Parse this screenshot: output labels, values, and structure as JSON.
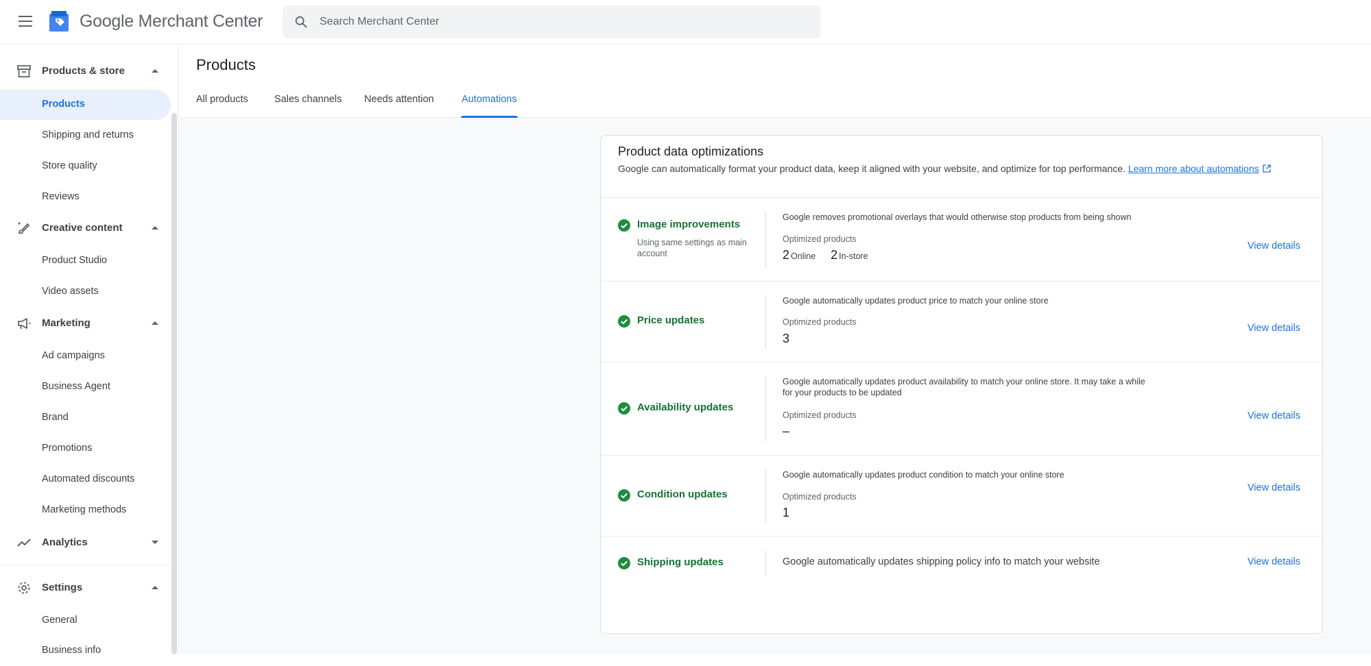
{
  "app": {
    "brand": "Google Merchant Center",
    "search_placeholder": "Search Merchant Center"
  },
  "sidebar": {
    "sections": [
      {
        "label": "Products & store",
        "icon": "store-icon",
        "expanded": true,
        "items": [
          {
            "label": "Products",
            "active": true
          },
          {
            "label": "Shipping and returns"
          },
          {
            "label": "Store quality"
          },
          {
            "label": "Reviews"
          }
        ]
      },
      {
        "label": "Creative content",
        "icon": "brush-icon",
        "expanded": true,
        "items": [
          {
            "label": "Product Studio"
          },
          {
            "label": "Video assets"
          }
        ]
      },
      {
        "label": "Marketing",
        "icon": "megaphone-icon",
        "expanded": true,
        "items": [
          {
            "label": "Ad campaigns"
          },
          {
            "label": "Business Agent"
          },
          {
            "label": "Brand"
          },
          {
            "label": "Promotions"
          },
          {
            "label": "Automated discounts"
          },
          {
            "label": "Marketing methods"
          }
        ]
      },
      {
        "label": "Analytics",
        "icon": "trending-icon",
        "expanded": false,
        "items": []
      },
      {
        "label": "Settings",
        "icon": "gear-icon",
        "expanded": true,
        "items": [
          {
            "label": "General"
          },
          {
            "label": "Business info"
          }
        ]
      }
    ]
  },
  "page": {
    "title": "Products",
    "tabs": [
      {
        "label": "All products"
      },
      {
        "label": "Sales channels"
      },
      {
        "label": "Needs attention"
      },
      {
        "label": "Automations",
        "active": true
      }
    ]
  },
  "card": {
    "title": "Product data optimizations",
    "description": "Google can automatically format your product data, keep it aligned with your website, and optimize for top performance.",
    "learn_more": "Learn more about automations",
    "view_details": "View details",
    "optimized_label": "Optimized products",
    "rows": [
      {
        "title": "Image improvements",
        "subtitle": "Using same settings as main account",
        "description": "Google removes promotional overlays that would otherwise stop products from being shown",
        "online_value": "2",
        "online_label": "Online",
        "instore_value": "2",
        "instore_label": "In-store"
      },
      {
        "title": "Price updates",
        "description": "Google automatically updates product price to match your online store",
        "value": "3"
      },
      {
        "title": "Availability updates",
        "description": "Google automatically updates product availability to match your online store. It may take a while for your products to be updated",
        "value": "–"
      },
      {
        "title": "Condition updates",
        "description": "Google automatically updates product condition to match your online store",
        "value": "1"
      },
      {
        "title": "Shipping updates",
        "description": "Google automatically updates shipping policy info to match your website"
      }
    ]
  },
  "colors": {
    "accent": "#1a73e8",
    "success": "#137333",
    "check": "#1e8e3e",
    "active_nav_bg": "#e8f0fe"
  }
}
